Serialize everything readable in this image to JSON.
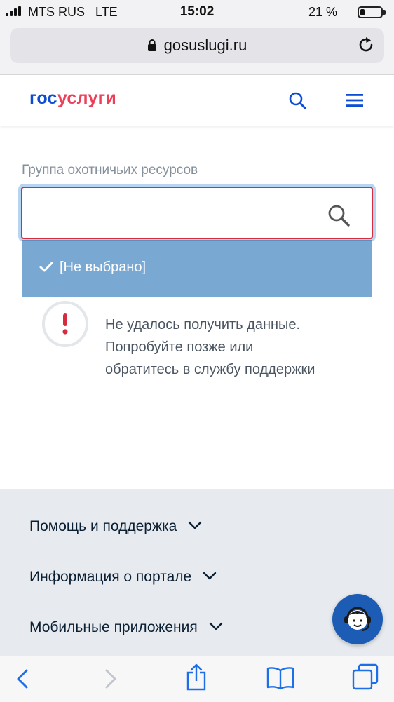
{
  "status_bar": {
    "carrier": "MTS RUS",
    "network": "LTE",
    "time": "15:02",
    "battery_percent": "21 %",
    "battery_level": 0.21
  },
  "browser": {
    "url": "gosuslugi.ru",
    "icons": [
      "lock-icon",
      "reload-icon",
      "back-icon",
      "forward-icon",
      "share-icon",
      "bookmarks-icon",
      "tabs-icon"
    ]
  },
  "header": {
    "logo_part1": "гос",
    "logo_part2": "услуги",
    "icons": [
      "search-icon",
      "menu-icon"
    ]
  },
  "form": {
    "field_label": "Группа охотничьих ресурсов",
    "select_value": "",
    "options": [
      {
        "label": "[Не выбрано]",
        "selected": true
      }
    ]
  },
  "error": {
    "lines": [
      "Не удалось получить данные.",
      "Попробуйте позже или",
      "обратитесь в службу поддержки"
    ]
  },
  "footer": {
    "items": [
      {
        "label": "Помощь и поддержка"
      },
      {
        "label": "Информация о портале"
      },
      {
        "label": "Мобильные приложения"
      }
    ]
  },
  "colors": {
    "brand_blue": "#0d4cd3",
    "brand_red": "#ee3f58",
    "error_red": "#d62c3f",
    "dropdown_bg": "#79a8d2",
    "footer_bg": "#e7ebef"
  }
}
